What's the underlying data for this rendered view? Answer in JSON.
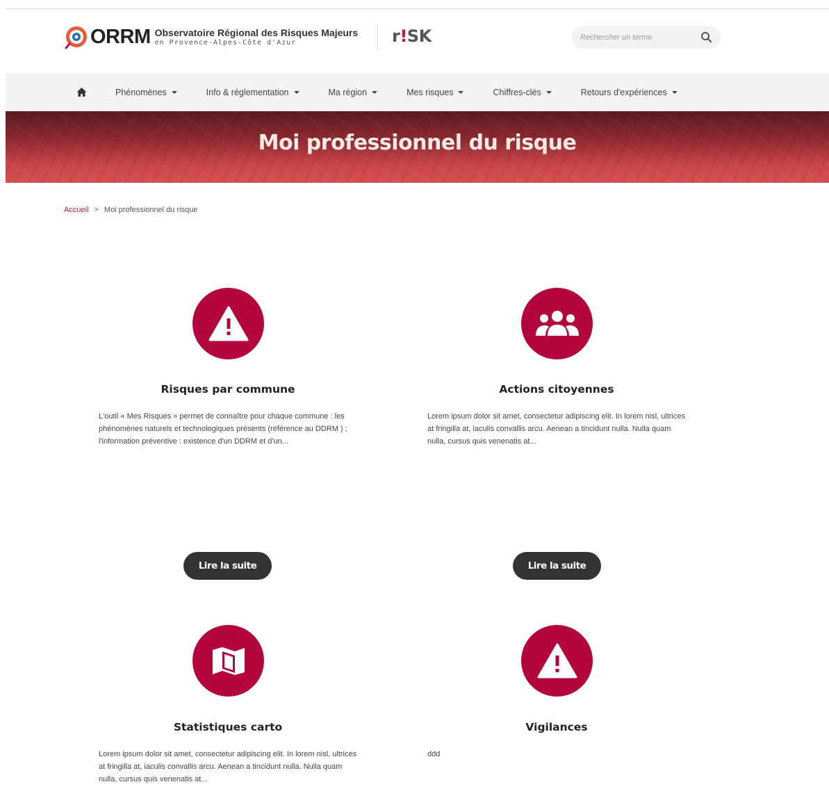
{
  "header": {
    "logo_word": "ORRM",
    "logo_title": "Observatoire Régional des Risques Majeurs",
    "logo_subtitle": "en Provence-Alpes-Côte d'Azur",
    "risk_logo_r": "r",
    "risk_logo_bang": "!",
    "risk_logo_rest": "SK",
    "search_placeholder": "Rechercher un terme"
  },
  "nav": {
    "items": [
      {
        "label": "Phénomènes"
      },
      {
        "label": "Info & réglementation"
      },
      {
        "label": "Ma région"
      },
      {
        "label": "Mes risques"
      },
      {
        "label": "Chiffres-clés"
      },
      {
        "label": "Retours d'expériences"
      }
    ]
  },
  "banner": {
    "title": "Moi professionnel du risque"
  },
  "breadcrumb": {
    "home": "Accueil",
    "separator": ">",
    "current": "Moi professionnel du risque"
  },
  "cards": [
    {
      "icon": "warning-icon",
      "title": "Risques par commune",
      "text": "L'outil « Mes Risques » permet de connaître pour chaque commune : les phénomènes naturels et technologiques présents (référence au DDRM ) ; l'information préventive : existence d'un DDRM et d'un...",
      "button": "Lire la suite"
    },
    {
      "icon": "users-icon",
      "title": "Actions citoyennes",
      "text": "Lorem ipsum dolor sit amet, consectetur adipiscing elit. In lorem nisl, ultrices at fringilla at, iaculis convallis arcu. Aenean a tincidunt nulla. Nulla quam nulla, cursus quis venenatis at...",
      "button": "Lire la suite"
    },
    {
      "icon": "map-icon",
      "title": "Statistiques carto",
      "text": "Lorem ipsum dolor sit amet, consectetur adipiscing elit. In lorem nisl, ultrices at fringilla at, iaculis convallis arcu. Aenean a tincidunt nulla. Nulla quam nulla, cursus quis venenatis at..."
    },
    {
      "icon": "warning-icon",
      "title": "Vigilances",
      "text": "ddd"
    }
  ],
  "colors": {
    "accent": "#b3063c",
    "button_bg": "#333333",
    "nav_bg": "#f3f3f3"
  }
}
